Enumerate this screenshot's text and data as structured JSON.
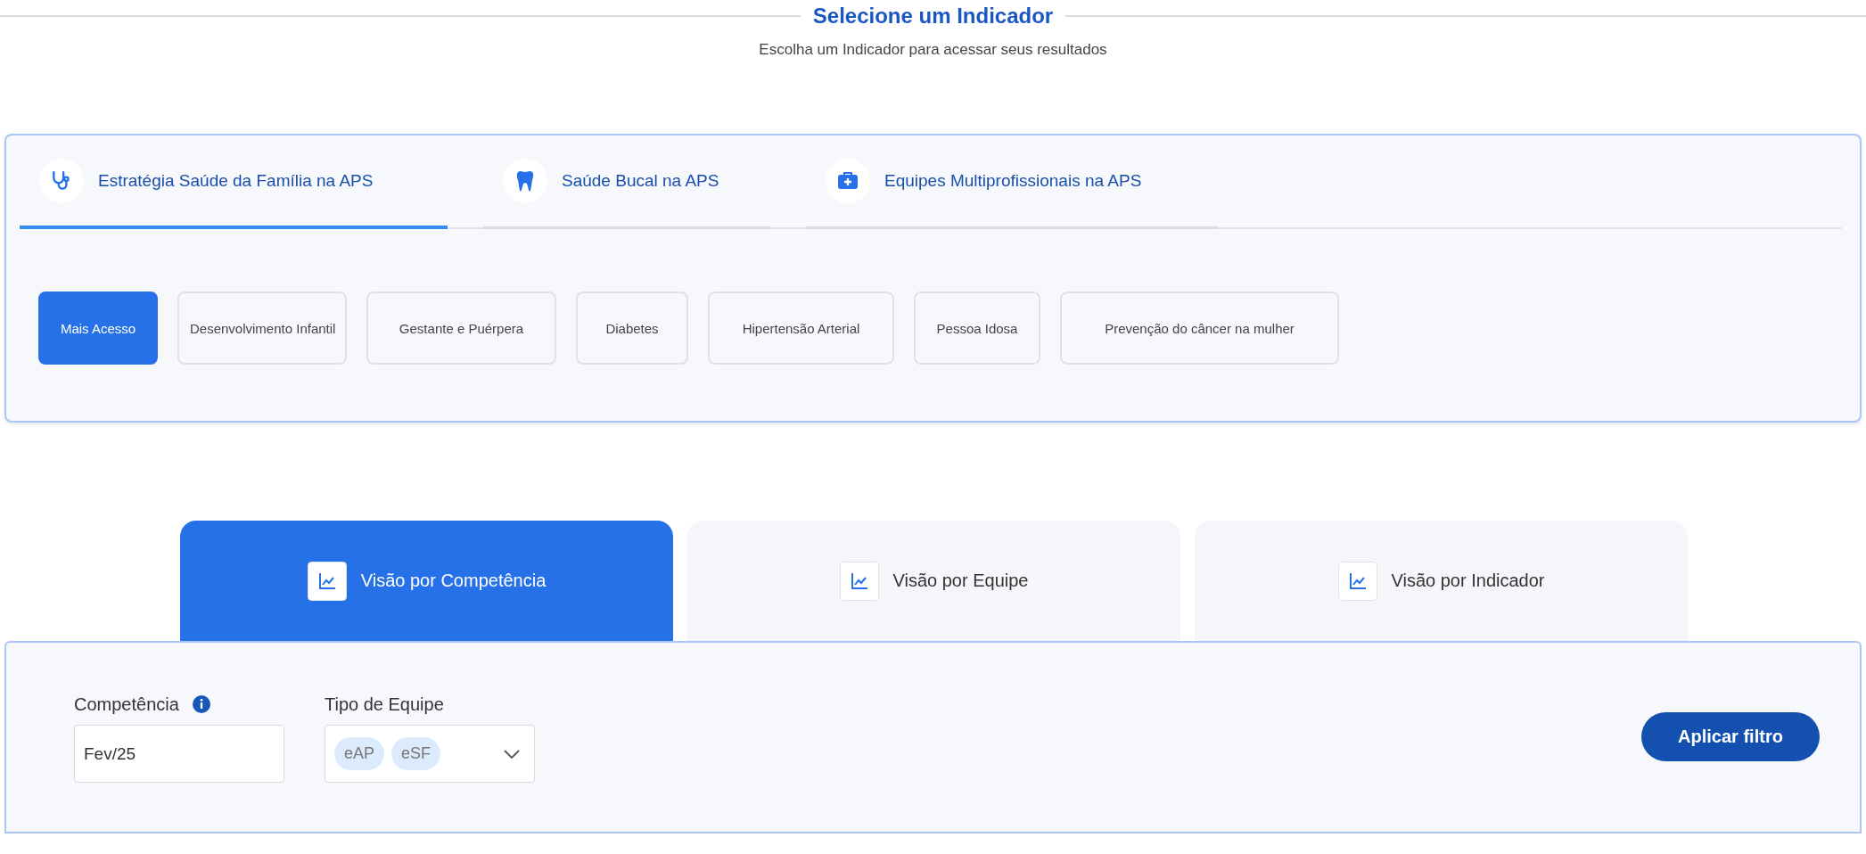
{
  "header": {
    "title": "Selecione um Indicador",
    "subtitle": "Escolha um Indicador para acessar seus resultados"
  },
  "category_tabs": [
    {
      "label": "Estratégia Saúde da Família na APS",
      "selected": true,
      "kind": "stethoscope"
    },
    {
      "label": "Saúde Bucal na APS",
      "selected": false,
      "kind": "tooth"
    },
    {
      "label": "Equipes Multiprofissionais na APS",
      "selected": false,
      "kind": "medkit"
    }
  ],
  "indicator_chips": [
    {
      "label": "Mais Acesso",
      "selected": true
    },
    {
      "label": "Desenvolvimento Infantil",
      "selected": false
    },
    {
      "label": "Gestante e Puérpera",
      "selected": false
    },
    {
      "label": "Diabetes",
      "selected": false
    },
    {
      "label": "Hipertensão Arterial",
      "selected": false
    },
    {
      "label": "Pessoa Idosa",
      "selected": false
    },
    {
      "label": "Prevenção do câncer na mulher",
      "selected": false
    }
  ],
  "view_tabs": [
    {
      "label": "Visão por Competência",
      "selected": true
    },
    {
      "label": "Visão por Equipe",
      "selected": false
    },
    {
      "label": "Visão por Indicador",
      "selected": false
    }
  ],
  "filters": {
    "competencia": {
      "label": "Competência",
      "value": "Fev/25"
    },
    "tipo_equipe": {
      "label": "Tipo de Equipe",
      "tags": [
        "eAP",
        "eSF"
      ]
    },
    "apply_button": "Aplicar filtro"
  }
}
